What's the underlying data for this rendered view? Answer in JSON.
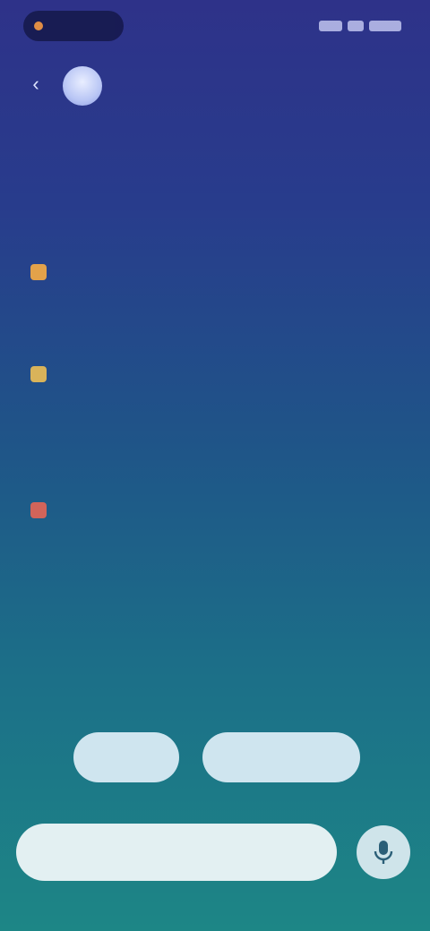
{
  "status_bar": {
    "pill_label": "",
    "indicator_color": "#ff9d3a"
  },
  "nav": {
    "back_icon": "back-arrow-icon",
    "avatar_icon": "assistant-avatar"
  },
  "message": {
    "heading": "",
    "subtitle": "",
    "items": [
      {
        "badge_color": "#e3a24a",
        "text": ""
      },
      {
        "badge_color": "#d9b35a",
        "text": ""
      },
      {
        "badge_color": "#d2645a",
        "text": ""
      }
    ],
    "footnote": ""
  },
  "suggestions": [
    {
      "label": ""
    },
    {
      "label": ""
    }
  ],
  "composer": {
    "placeholder": "",
    "value": "",
    "mic_icon": "microphone-icon"
  },
  "colors": {
    "background_top": "#2e3289",
    "background_bottom": "#1d8686",
    "chip_bg": "#cfe5ef",
    "input_bg": "#e3f0f2"
  }
}
